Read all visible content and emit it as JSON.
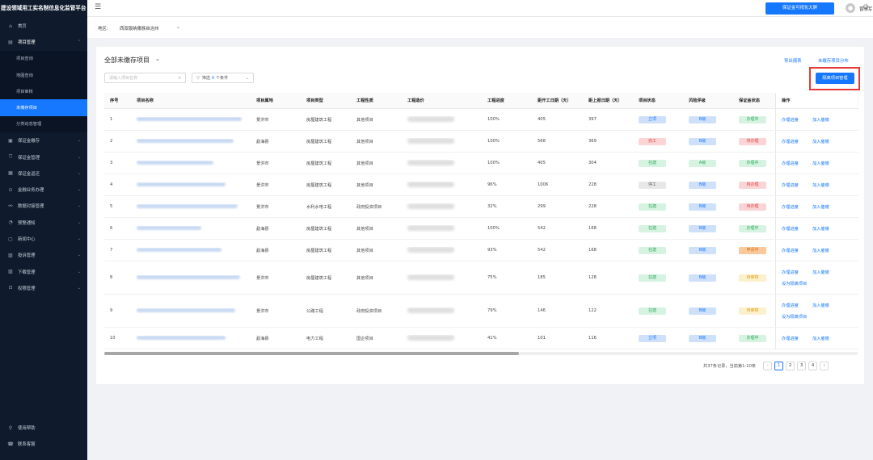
{
  "app": {
    "title": "建设领域用工实名制信息化监管平台"
  },
  "sidebar": {
    "items": [
      {
        "label": "首页",
        "icon": "home-icon",
        "glyph": "⌂"
      },
      {
        "label": "项目管理",
        "icon": "project-icon",
        "glyph": "▤",
        "open": true
      },
      {
        "label": "保证金缴存",
        "icon": "deposit-icon",
        "glyph": "▣"
      },
      {
        "label": "保证金管理",
        "icon": "shield-icon",
        "glyph": "⛉"
      },
      {
        "label": "保证金返还",
        "icon": "return-icon",
        "glyph": "▦"
      },
      {
        "label": "金融业务办理",
        "icon": "finance-icon",
        "glyph": "⊙"
      },
      {
        "label": "数据对接管理",
        "icon": "data-icon",
        "glyph": "⚯"
      },
      {
        "label": "预警通知",
        "icon": "alert-icon",
        "glyph": "◔"
      },
      {
        "label": "新闻中心",
        "icon": "news-icon",
        "glyph": "▢"
      },
      {
        "label": "投诉管理",
        "icon": "complaint-icon",
        "glyph": "▧"
      },
      {
        "label": "下载管理",
        "icon": "download-icon",
        "glyph": "▨"
      },
      {
        "label": "权限管理",
        "icon": "lock-icon",
        "glyph": "⊡"
      }
    ],
    "sub_items": [
      {
        "label": "项目查询"
      },
      {
        "label": "地图查询"
      },
      {
        "label": "项目审核"
      },
      {
        "label": "未缴存项目",
        "active": true
      },
      {
        "label": "分类动态管理"
      }
    ],
    "bottom": [
      {
        "label": "使用帮助",
        "icon": "help-icon",
        "glyph": "⚲"
      },
      {
        "label": "联系客服",
        "icon": "service-icon",
        "glyph": "☎"
      }
    ]
  },
  "topbar": {
    "big_screen_button": "保证金可视化大屏",
    "user_name": "曾晓军"
  },
  "region": {
    "label": "地区:",
    "value": "西双版纳傣族自治州"
  },
  "panel": {
    "title": "全部未缴存项目",
    "export_link": "导出报表",
    "distribution_link": "未缴存项目分布",
    "search_placeholder": "请输入项目名称",
    "filter_label": "筛选",
    "filter_count": "0",
    "filter_suffix": "个条件",
    "isolate_button": "隔离项目管理"
  },
  "table": {
    "headers": [
      "序号",
      "项目名称",
      "项目属地",
      "项目类型",
      "工程性质",
      "工程造价",
      "工程进度",
      "距开工日期（天）",
      "距上报日期（天）",
      "项目状态",
      "风险评级",
      "保证金状态",
      "操作"
    ],
    "rows": [
      {
        "no": "1",
        "loc": "景洪市",
        "type": "房屋建筑工程",
        "nature": "其他项目",
        "progress": "100%",
        "d1": "405",
        "d2": "397",
        "status": "立项",
        "status_c": "t-blue",
        "risk": "B级",
        "risk_c": "t-blue",
        "dep": "办理中",
        "dep_c": "t-green",
        "ops": [
          "办理进度",
          "加入催缴"
        ],
        "h": 27,
        "nw": 130
      },
      {
        "no": "2",
        "loc": "勐海县",
        "type": "房屋建筑工程",
        "nature": "其他项目",
        "progress": "100%",
        "d1": "568",
        "d2": "369",
        "status": "完工",
        "status_c": "t-red",
        "risk": "B级",
        "risk_c": "t-blue",
        "dep": "待办理",
        "dep_c": "t-red",
        "ops": [
          "办理进度",
          "加入催缴"
        ],
        "h": 27,
        "nw": 120
      },
      {
        "no": "3",
        "loc": "景洪市",
        "type": "房屋建筑工程",
        "nature": "其他项目",
        "progress": "100%",
        "d1": "405",
        "d2": "304",
        "status": "在建",
        "status_c": "t-green",
        "risk": "A级",
        "risk_c": "t-green",
        "dep": "办理中",
        "dep_c": "t-green",
        "ops": [
          "办理进度",
          "加入催缴"
        ],
        "h": 27,
        "nw": 95
      },
      {
        "no": "4",
        "loc": "景洪市",
        "type": "房屋建筑工程",
        "nature": "其他项目",
        "progress": "96%",
        "d1": "1006",
        "d2": "228",
        "status": "停工",
        "status_c": "t-gray",
        "risk": "B级",
        "risk_c": "t-blue",
        "dep": "待办理",
        "dep_c": "t-red",
        "ops": [
          "办理进度",
          "加入催缴"
        ],
        "h": 27,
        "nw": 110
      },
      {
        "no": "5",
        "loc": "景洪市",
        "type": "水利水电工程",
        "nature": "政府投资项目",
        "progress": "32%",
        "d1": "299",
        "d2": "228",
        "status": "在建",
        "status_c": "t-green",
        "risk": "B级",
        "risk_c": "t-blue",
        "dep": "待办理",
        "dep_c": "t-red",
        "ops": [
          "办理进度",
          "加入催缴"
        ],
        "h": 27,
        "nw": 125
      },
      {
        "no": "6",
        "loc": "勐海县",
        "type": "房屋建筑工程",
        "nature": "其他项目",
        "progress": "100%",
        "d1": "542",
        "d2": "168",
        "status": "在建",
        "status_c": "t-green",
        "risk": "B级",
        "risk_c": "t-blue",
        "dep": "办理中",
        "dep_c": "t-green",
        "ops": [
          "办理进度",
          "加入催缴"
        ],
        "h": 27,
        "nw": 80
      },
      {
        "no": "7",
        "loc": "勐海县",
        "type": "房屋建筑工程",
        "nature": "其他项目",
        "progress": "93%",
        "d1": "542",
        "d2": "168",
        "status": "在建",
        "status_c": "t-green",
        "risk": "B级",
        "risk_c": "t-blue",
        "dep": "申请中",
        "dep_c": "t-orange",
        "ops": [
          "办理进度",
          "加入催缴"
        ],
        "h": 27,
        "nw": 105
      },
      {
        "no": "8",
        "loc": "景洪市",
        "type": "房屋建筑工程",
        "nature": "其他项目",
        "progress": "75%",
        "d1": "185",
        "d2": "128",
        "status": "在建",
        "status_c": "t-green",
        "risk": "B级",
        "risk_c": "t-blue",
        "dep": "待审核",
        "dep_c": "t-yellow",
        "ops": [
          "办理进度",
          "加入催缴",
          "设为隔离项目"
        ],
        "h": 41,
        "nw": 128
      },
      {
        "no": "9",
        "loc": "景洪市",
        "type": "公路工程",
        "nature": "政府投资项目",
        "progress": "79%",
        "d1": "146",
        "d2": "122",
        "status": "在建",
        "status_c": "t-green",
        "risk": "B级",
        "risk_c": "t-blue",
        "dep": "待审核",
        "dep_c": "t-yellow",
        "ops": [
          "办理进度",
          "加入催缴",
          "设为隔离项目"
        ],
        "h": 41,
        "nw": 122
      },
      {
        "no": "10",
        "loc": "勐海县",
        "type": "电力工程",
        "nature": "国企项目",
        "progress": "41%",
        "d1": "101",
        "d2": "116",
        "status": "立项",
        "status_c": "t-blue",
        "risk": "B级",
        "risk_c": "t-blue",
        "dep": "办理中",
        "dep_c": "t-green",
        "ops": [
          "办理进度",
          "加入催缴"
        ],
        "h": 27,
        "nw": 110
      }
    ]
  },
  "pagination": {
    "info": "共37条记录，当前第1-10条",
    "pages": [
      "1",
      "2",
      "3",
      "4"
    ],
    "current": "1",
    "prev": "‹",
    "next": "›"
  }
}
